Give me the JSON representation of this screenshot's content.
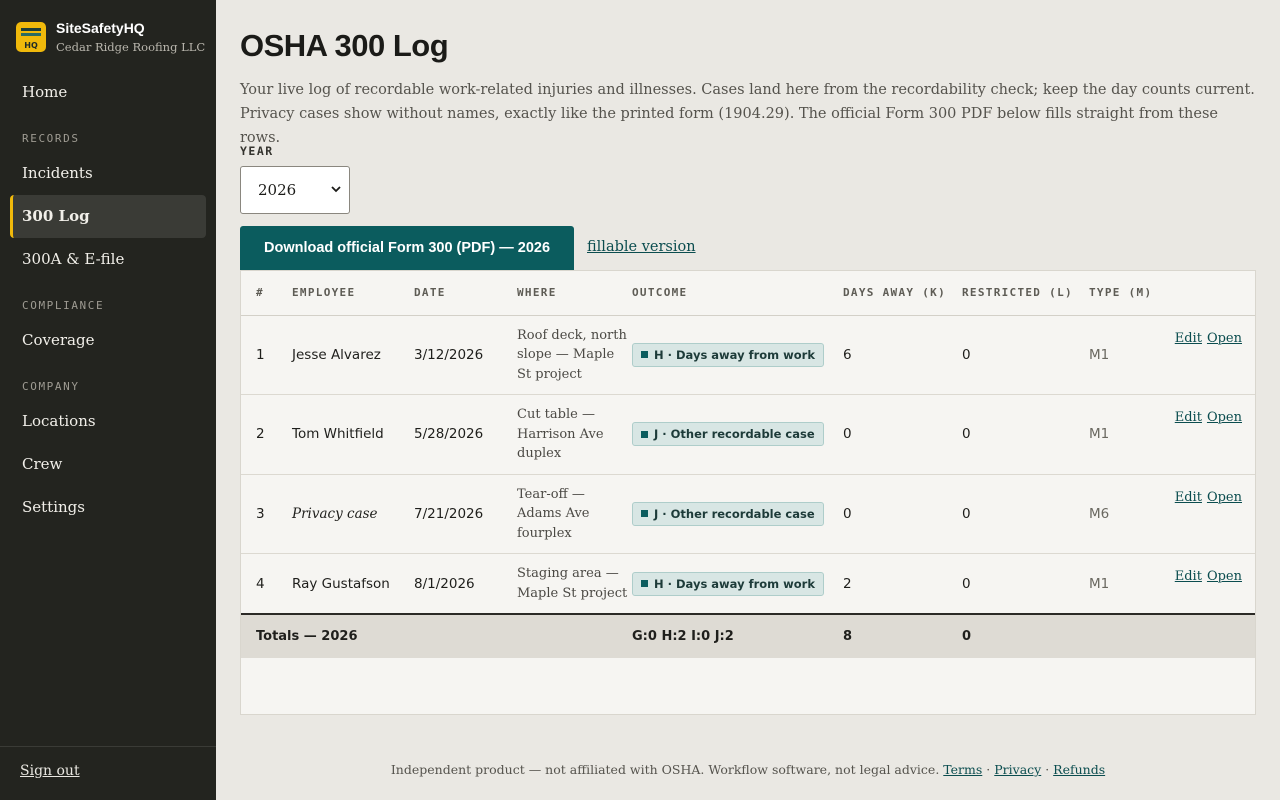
{
  "brand": {
    "name": "SiteSafetyHQ",
    "company": "Cedar Ridge Roofing LLC",
    "logo_text": "HQ"
  },
  "nav": {
    "home": "Home",
    "section_records": "RECORDS",
    "incidents": "Incidents",
    "log300": "300 Log",
    "e_file": "300A & E-file",
    "section_compliance": "COMPLIANCE",
    "coverage": "Coverage",
    "section_company": "COMPANY",
    "locations": "Locations",
    "crew": "Crew",
    "settings": "Settings",
    "active": "300 Log"
  },
  "sign_out": "Sign out",
  "page": {
    "title": "OSHA 300 Log",
    "intro": "Your live log of recordable work-related injuries and illnesses. Cases land here from the recordability check; keep the day counts current. Privacy cases show without names, exactly like the printed form (1904.29). The official Form 300 PDF below fills straight from these rows.",
    "year_label": "YEAR",
    "year_value": "2026",
    "download_label": "Download official Form 300 (PDF) — 2026",
    "fillable_label": "fillable version"
  },
  "table": {
    "headers": {
      "num": "#",
      "employee": "EMPLOYEE",
      "date": "DATE",
      "where": "WHERE",
      "outcome": "OUTCOME",
      "days_away": "DAYS AWAY (K)",
      "restricted": "RESTRICTED (L)",
      "type": "TYPE (M)"
    },
    "rows": [
      {
        "num": "1",
        "employee": "Jesse Alvarez",
        "date": "3/12/2026",
        "where": "Roof deck, north slope — Maple St project",
        "outcome": "H · Days away from work",
        "days_away": "6",
        "restricted": "0",
        "type": "M1",
        "edit": "Edit",
        "open": "Open"
      },
      {
        "num": "2",
        "employee": "Tom Whitfield",
        "date": "5/28/2026",
        "where": "Cut table — Harrison Ave duplex",
        "outcome": "J · Other recordable case",
        "days_away": "0",
        "restricted": "0",
        "type": "M1",
        "edit": "Edit",
        "open": "Open"
      },
      {
        "num": "3",
        "employee": "Privacy case",
        "date": "7/21/2026",
        "where": "Tear-off — Adams Ave fourplex",
        "outcome": "J · Other recordable case",
        "days_away": "0",
        "restricted": "0",
        "type": "M6",
        "edit": "Edit",
        "open": "Open"
      },
      {
        "num": "4",
        "employee": "Ray Gustafson",
        "date": "8/1/2026",
        "where": "Staging area — Maple St project",
        "outcome": "H · Days away from work",
        "days_away": "2",
        "restricted": "0",
        "type": "M1",
        "edit": "Edit",
        "open": "Open"
      }
    ],
    "totals": {
      "label": "Totals — 2026",
      "outcome": "G:0 H:2 I:0 J:2",
      "days_away": "8",
      "restricted": "0"
    }
  },
  "footer": {
    "text": "Independent product — not affiliated with OSHA. Workflow software, not legal advice.",
    "terms": "Terms",
    "privacy": "Privacy",
    "refunds": "Refunds",
    "sep": "·"
  },
  "colors": {
    "accent": "#0b5c5e",
    "highlight": "#f0b90b",
    "sidebar_bg": "#23241f",
    "page_bg": "#eae8e3"
  }
}
